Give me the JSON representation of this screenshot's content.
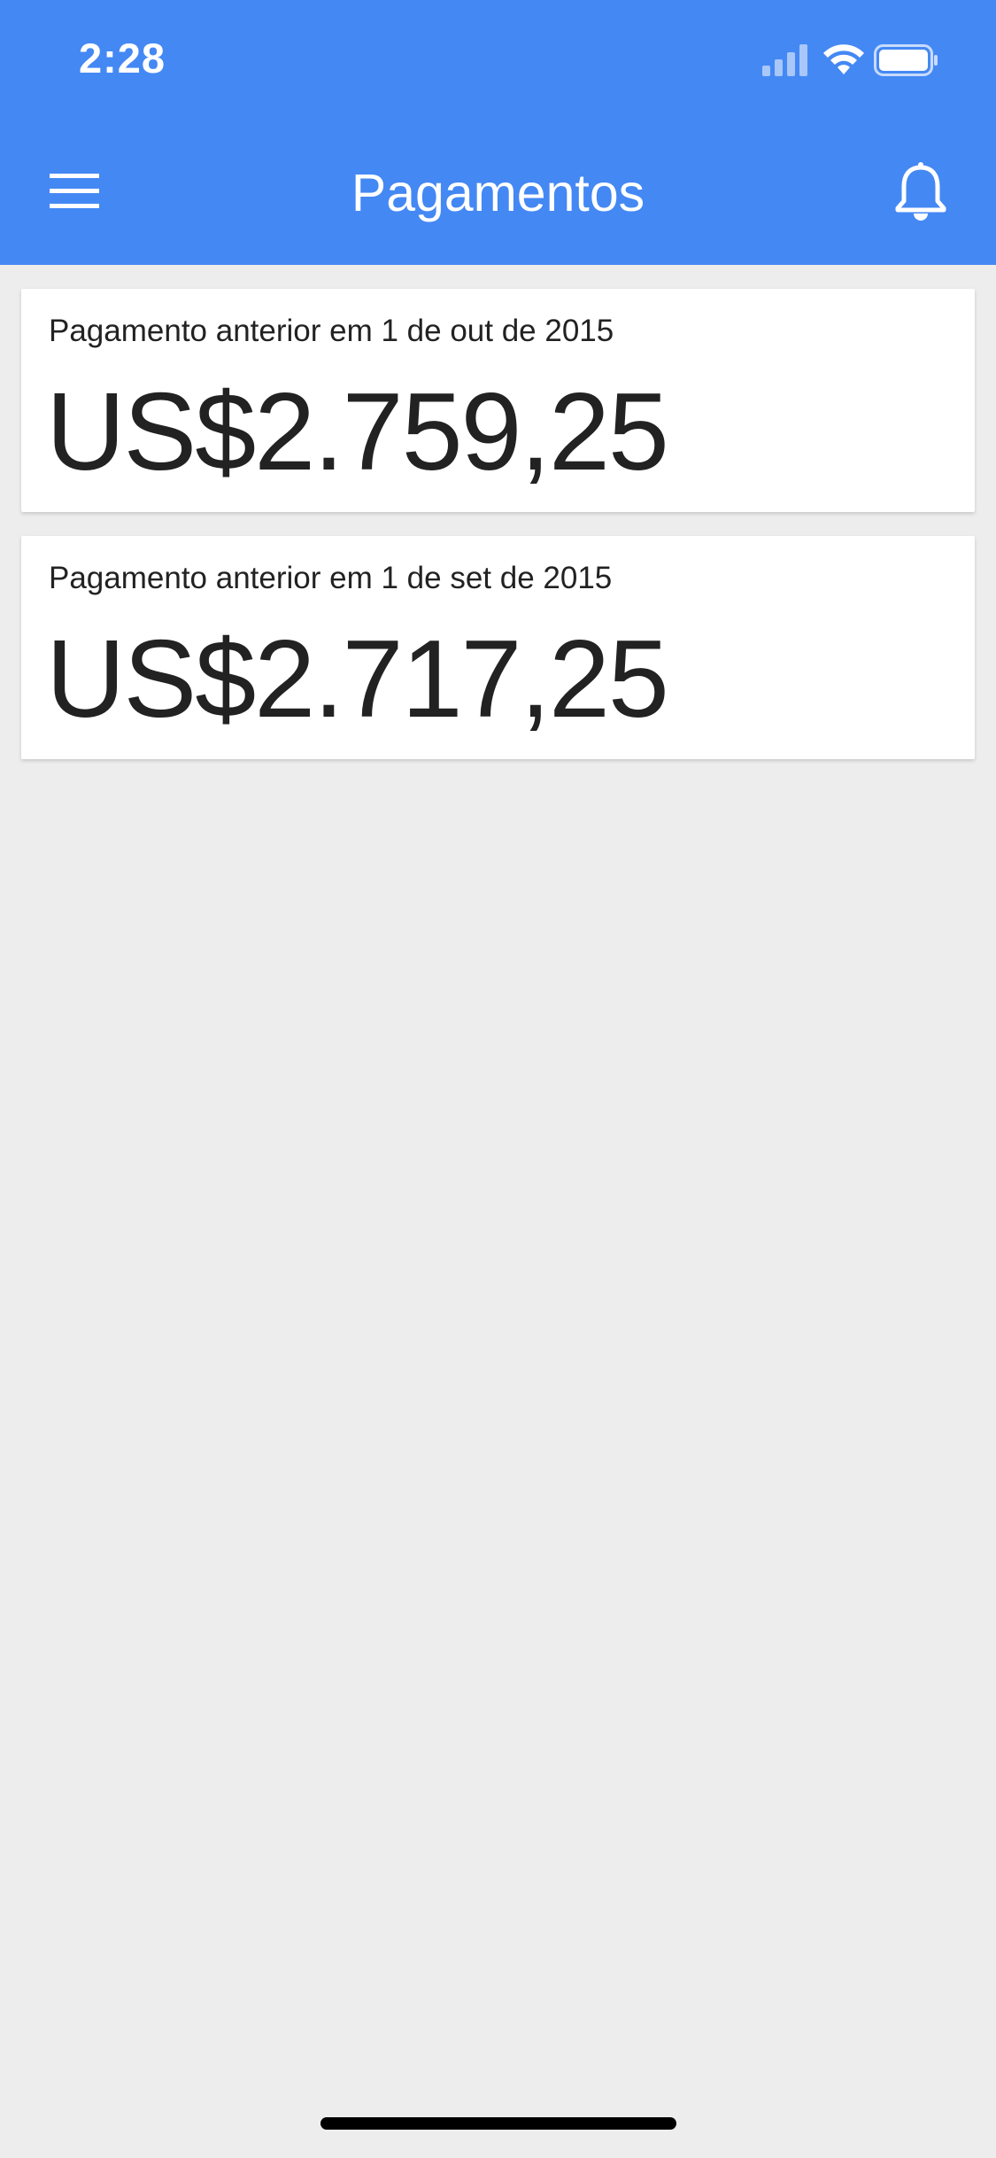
{
  "status_bar": {
    "time": "2:28"
  },
  "header": {
    "title": "Pagamentos",
    "menu_icon": "menu-icon",
    "bell_icon": "bell-icon",
    "background_color": "#4488f4"
  },
  "payments": [
    {
      "label": "Pagamento anterior em 1 de out de 2015",
      "amount": "US$2.759,25"
    },
    {
      "label": "Pagamento anterior em 1 de set de 2015",
      "amount": "US$2.717,25"
    }
  ],
  "colors": {
    "page_background": "#ededed",
    "card_background": "#ffffff",
    "text": "#222222"
  }
}
